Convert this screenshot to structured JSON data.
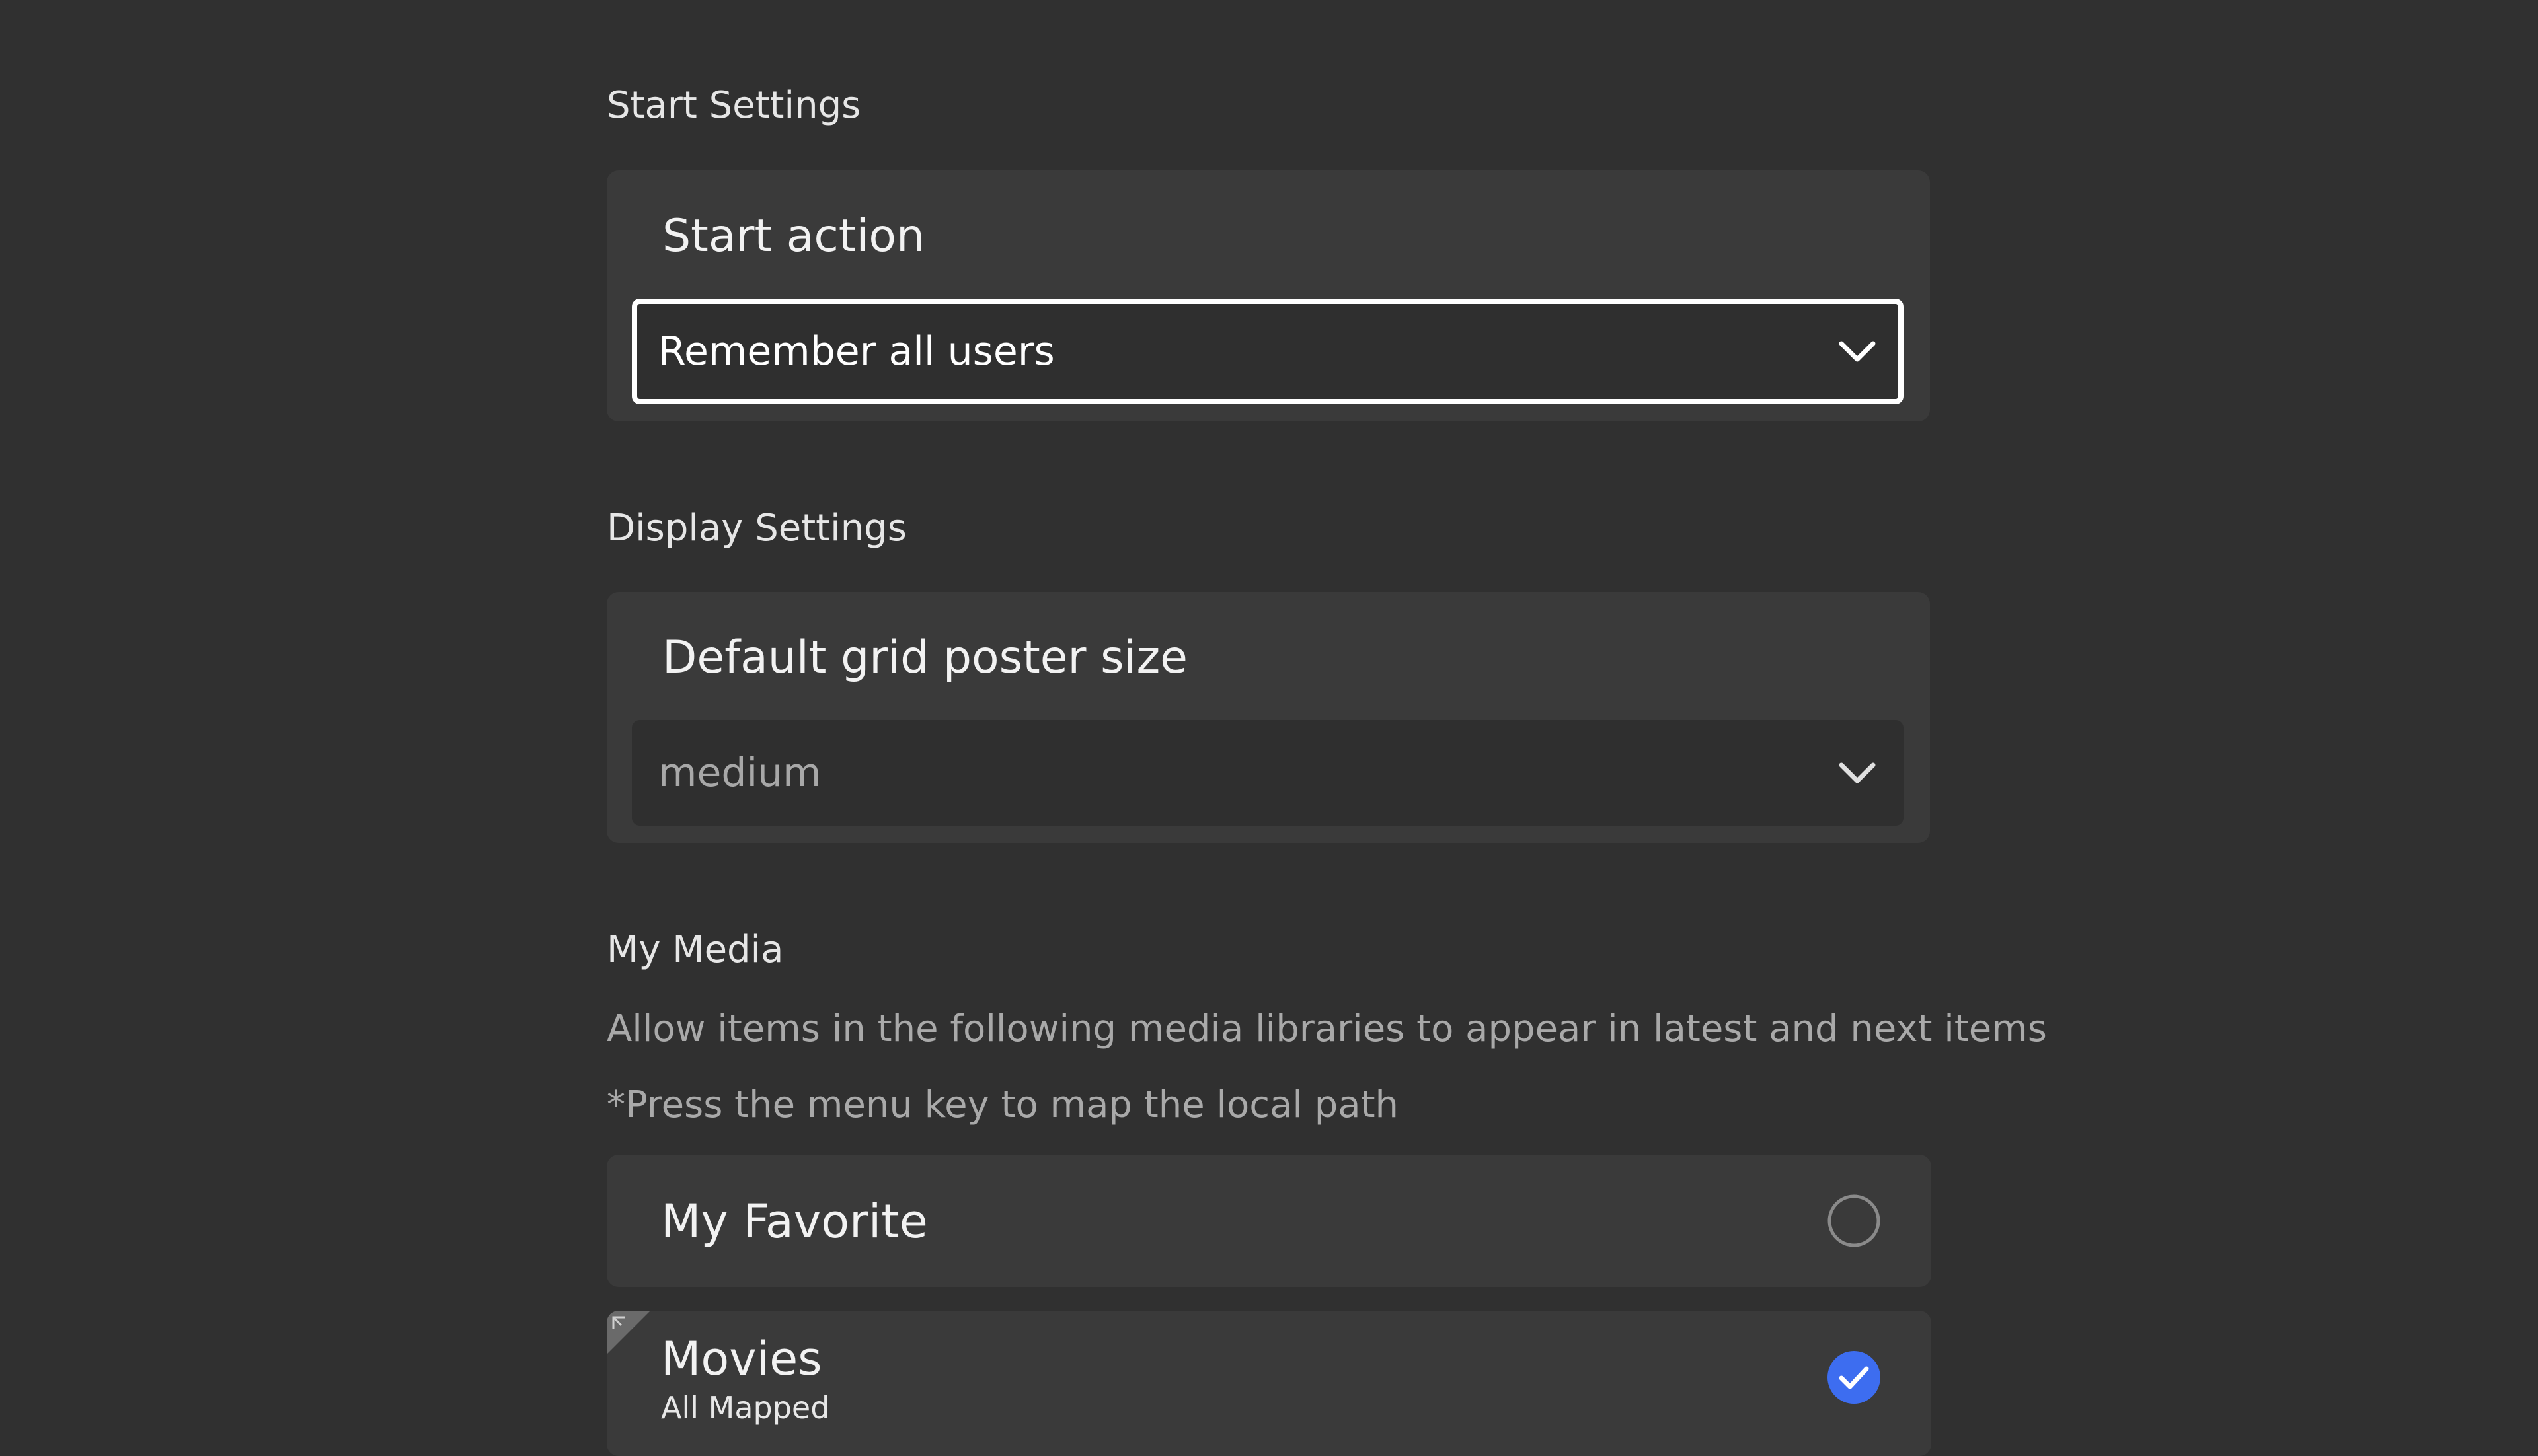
{
  "start_settings": {
    "section_title": "Start Settings",
    "label": "Start action",
    "value": "Remember all users"
  },
  "display_settings": {
    "section_title": "Display Settings",
    "label": "Default grid poster size",
    "value": "medium"
  },
  "my_media": {
    "section_title": "My Media",
    "description": "Allow items in the following media libraries to appear in latest and next items",
    "hint": "*Press the menu key to map the local path",
    "libraries": [
      {
        "name": "My Favorite",
        "subtitle": "",
        "checked": false
      },
      {
        "name": "Movies",
        "subtitle": "All Mapped",
        "checked": true
      }
    ]
  },
  "colors": {
    "background": "#303030",
    "card": "#3a3a3a",
    "focus_border": "#ffffff",
    "check_accent": "#3d6df0",
    "muted_text": "#a9a9a9"
  },
  "icons": {
    "dropdown": "chevron-down-icon",
    "unchecked": "radio-unchecked-icon",
    "checked": "check-circle-icon",
    "mapped": "mapped-corner-icon"
  }
}
